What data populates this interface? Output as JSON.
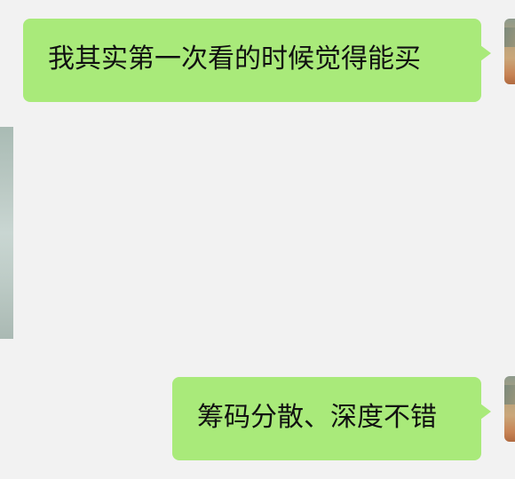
{
  "messages": [
    {
      "side": "right",
      "text": "我其实第一次看的时候觉得能买"
    },
    {
      "side": "right",
      "text": "筹码分散、深度不错"
    }
  ],
  "colors": {
    "background": "#f2f2f2",
    "sent_bubble": "#a9ea7a",
    "text": "#111111"
  }
}
